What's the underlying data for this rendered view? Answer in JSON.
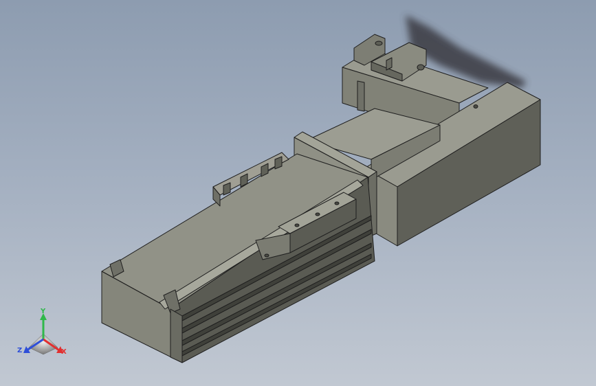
{
  "viewport": {
    "background_top": "#8d9cb0",
    "background_bottom": "#c1c8d2"
  },
  "model": {
    "face_light": "#8e8f84",
    "face_mid": "#7b7c72",
    "face_dark": "#56574f",
    "edge": "#1e1e1e",
    "shadow": "#3c3c44"
  },
  "triad": {
    "x_label": "X",
    "y_label": "Y",
    "z_label": "Z",
    "x_color": "#e23030",
    "y_color": "#2fb84a",
    "z_color": "#2f4fd8"
  }
}
